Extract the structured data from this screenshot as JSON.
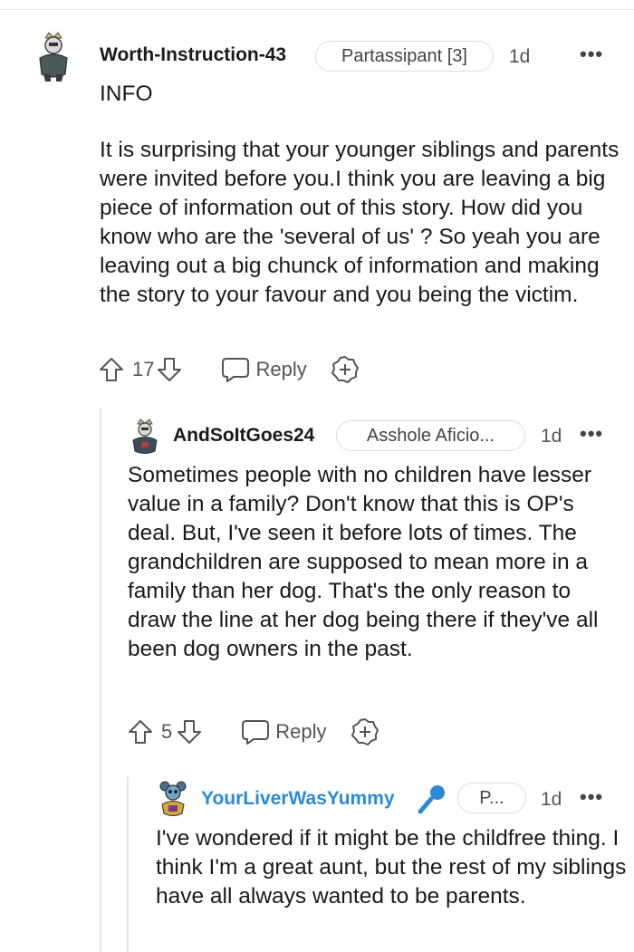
{
  "comments": [
    {
      "username": "Worth-Instruction-43",
      "flair": "Partassipant [3]",
      "time": "1d",
      "more": "•••",
      "paragraphs": [
        "INFO",
        "It is surprising that your younger siblings and parents were invited before you.I think you are leaving a big piece of information out of this story. How did you know who are the 'several of us' ? So yeah you are leaving out a big chunck of information and making the story to your favour and you being the victim."
      ],
      "votes": "17",
      "reply_label": "Reply"
    },
    {
      "username": "AndSoItGoes24",
      "flair": "Asshole Aficio...",
      "time": "1d",
      "more": "•••",
      "paragraphs": [
        "Sometimes people with no children have lesser value in a family? Don't know that this is OP's deal. But, I've seen it before lots of times. The grandchildren are supposed to mean more in a family than her dog. That's the only reason to draw the line at her dog being there if they've all been dog owners in the past."
      ],
      "votes": "5",
      "reply_label": "Reply"
    },
    {
      "username": "YourLiverWasYummy",
      "flair": "P...",
      "time": "1d",
      "more": "•••",
      "paragraphs": [
        "I've wondered if it might be the childfree thing. I think I'm a great aunt, but the rest of my siblings have all always wanted to be parents."
      ]
    }
  ],
  "colors": {
    "op_username": "#2b8ad8",
    "mic": "#2b8ad8"
  }
}
